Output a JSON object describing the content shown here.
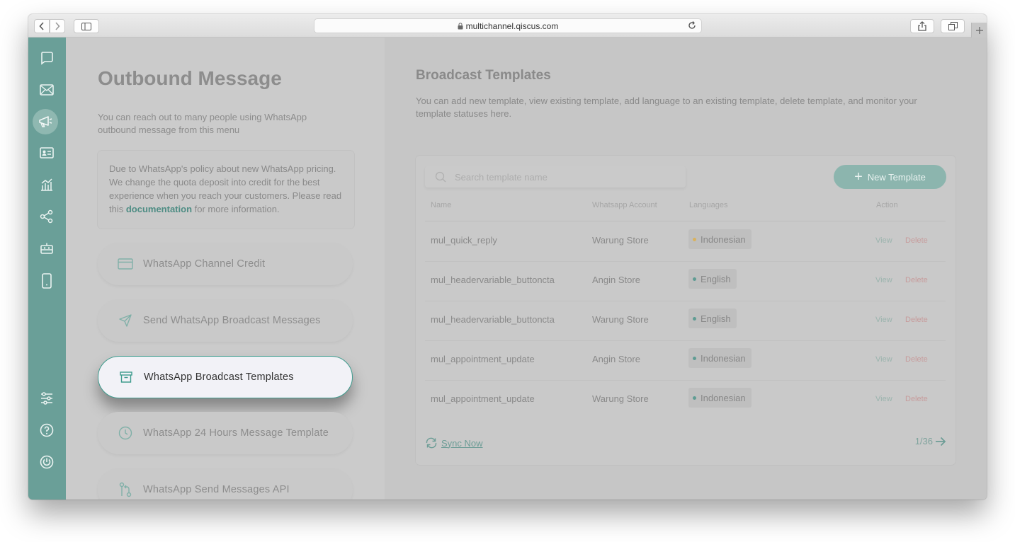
{
  "browser": {
    "url": "multichannel.qiscus.com"
  },
  "colors": {
    "accent": "#6a9f98",
    "link": "#4e8d84",
    "active_border": "#3f9c8e",
    "lang_indonesian": "#d9b25e",
    "lang_english": "#5f9c93",
    "delete": "#c79c9c"
  },
  "sidebar": {
    "icons": [
      "chat-icon",
      "mail-icon",
      "megaphone-icon",
      "contact-card-icon",
      "analytics-icon",
      "integration-icon",
      "bot-icon",
      "mobile-icon",
      "settings-icon",
      "help-icon",
      "power-icon"
    ]
  },
  "left": {
    "title": "Outbound Message",
    "description": "You can reach out to many people using WhatsApp outbound message from this menu",
    "notice_before": "Due to WhatsApp's policy about new WhatsApp pricing. We change the quota deposit into credit for the best experience when you reach your customers. Please read this ",
    "notice_link": "documentation",
    "notice_after": " for more information.",
    "menu": [
      {
        "label": "WhatsApp Channel Credit",
        "icon": "credit-card-icon"
      },
      {
        "label": "Send WhatsApp Broadcast Messages",
        "icon": "send-icon"
      },
      {
        "label": "WhatsApp Broadcast Templates",
        "icon": "archive-icon",
        "active": true
      },
      {
        "label": "WhatsApp 24 Hours Message Template",
        "icon": "clock-icon"
      },
      {
        "label": "WhatsApp Send Messages API",
        "icon": "api-icon"
      }
    ]
  },
  "right": {
    "title": "Broadcast Templates",
    "description": "You can add new template, view existing template, add language to an existing template, delete template, and monitor your template statuses here.",
    "search_placeholder": "Search template name",
    "new_button": "New Template",
    "columns": {
      "name": "Name",
      "account": "Whatsapp Account",
      "languages": "Languages",
      "action": "Action"
    },
    "rows": [
      {
        "name": "mul_quick_reply",
        "account": "Warung Store",
        "language": "Indonesian",
        "lang_color": "#d9b25e"
      },
      {
        "name": "mul_headervariable_buttoncta",
        "account": "Angin Store",
        "language": "English",
        "lang_color": "#5f9c93"
      },
      {
        "name": "mul_headervariable_buttoncta",
        "account": "Warung Store",
        "language": "English",
        "lang_color": "#5f9c93"
      },
      {
        "name": "mul_appointment_update",
        "account": "Angin Store",
        "language": "Indonesian",
        "lang_color": "#5f9c93"
      },
      {
        "name": "mul_appointment_update",
        "account": "Warung Store",
        "language": "Indonesian",
        "lang_color": "#5f9c93"
      }
    ],
    "view_label": "View",
    "delete_label": "Delete",
    "sync_label": "Sync Now",
    "pagination": "1/36"
  }
}
